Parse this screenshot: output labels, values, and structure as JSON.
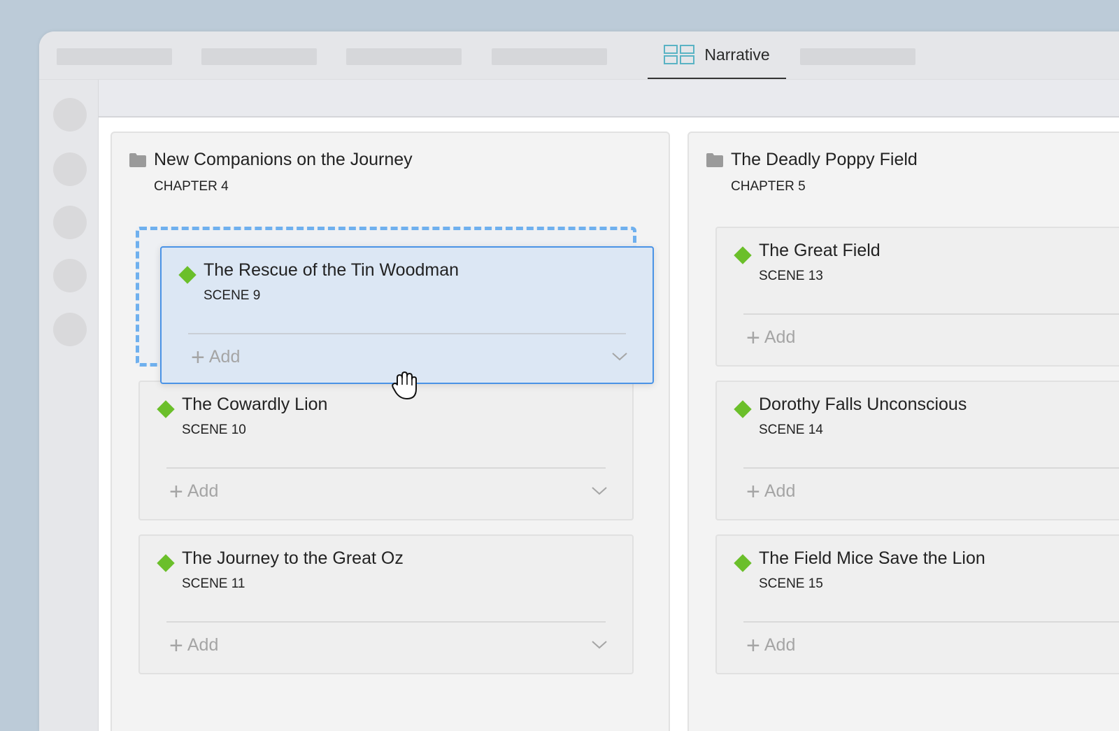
{
  "tabs": {
    "active_label": "Narrative"
  },
  "columns": [
    {
      "title": "New Companions on the Journey",
      "subtitle": "CHAPTER 4",
      "cards": [
        {
          "title": "The Cowardly Lion",
          "scene": "SCENE 10",
          "add_label": "Add"
        },
        {
          "title": "The Journey to the Great Oz",
          "scene": "SCENE 11",
          "add_label": "Add"
        }
      ]
    },
    {
      "title": "The Deadly Poppy Field",
      "subtitle": "CHAPTER 5",
      "cards": [
        {
          "title": "The Great Field",
          "scene": "SCENE 13",
          "add_label": "Add"
        },
        {
          "title": "Dorothy Falls Unconscious",
          "scene": "SCENE 14",
          "add_label": "Add"
        },
        {
          "title": "The Field Mice Save the Lion",
          "scene": "SCENE 15",
          "add_label": "Add"
        }
      ]
    }
  ],
  "dragging_card": {
    "title": "The Rescue of the Tin Woodman",
    "scene": "SCENE 9",
    "add_label": "Add"
  },
  "colors": {
    "accent": "#4a93e6",
    "scene_marker": "#6bbf2a",
    "tab_icon": "#5ab3c4"
  },
  "icons": {
    "tab_icon": "grid-icon",
    "folder": "folder-icon",
    "scene_marker": "diamond-icon",
    "cursor": "grab-hand-icon"
  }
}
